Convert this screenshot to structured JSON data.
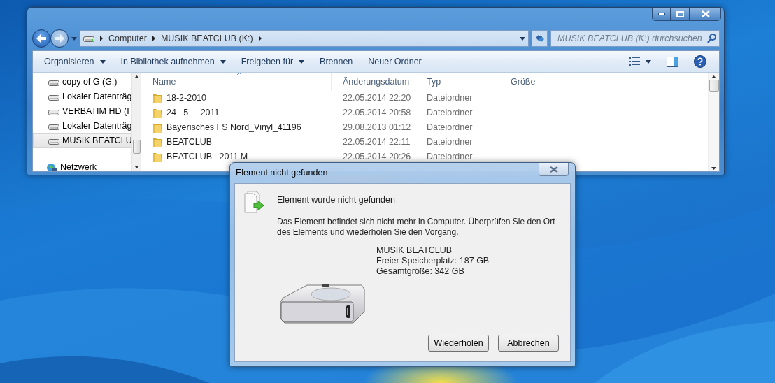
{
  "explorer": {
    "address": {
      "crumbs": [
        "Computer",
        "MUSIK BEATCLUB (K:)"
      ]
    },
    "search": {
      "placeholder": "MUSIK BEATCLUB (K:) durchsuchen"
    },
    "toolbar": [
      {
        "label": "Organisieren",
        "dropdown": true
      },
      {
        "label": "In Bibliothek aufnehmen",
        "dropdown": true
      },
      {
        "label": "Freigeben für",
        "dropdown": true
      },
      {
        "label": "Brennen",
        "dropdown": false
      },
      {
        "label": "Neuer Ordner",
        "dropdown": false
      }
    ],
    "nav": [
      {
        "label": "copy of G (G:)",
        "kind": "drive",
        "selected": false
      },
      {
        "label": "Lokaler Datenträg",
        "kind": "drive",
        "selected": false
      },
      {
        "label": "VERBATIM HD (I",
        "kind": "drive",
        "selected": false
      },
      {
        "label": "Lokaler Datenträg",
        "kind": "drive",
        "selected": false
      },
      {
        "label": "MUSIK BEATCLU",
        "kind": "drive",
        "selected": true
      },
      {
        "label": "Netzwerk",
        "kind": "network",
        "selected": false
      }
    ],
    "columns": [
      {
        "label": "Name",
        "sorted": true
      },
      {
        "label": "Änderungsdatum",
        "sorted": false
      },
      {
        "label": "Typ",
        "sorted": false
      },
      {
        "label": "Größe",
        "sorted": false
      }
    ],
    "rows": [
      {
        "name": "18-2-2010",
        "date": "22.05.2014 22:20",
        "type": "Dateiordner"
      },
      {
        "name": "24   5     2011",
        "date": "22.05.2014 20:58",
        "type": "Dateiordner"
      },
      {
        "name": "Bayerisches FS Nord_Vinyl_41196",
        "date": "29.08.2013 01:12",
        "type": "Dateiordner"
      },
      {
        "name": "BEATCLUB",
        "date": "22.05.2014 22:11",
        "type": "Dateiordner"
      },
      {
        "name": "BEATCLUB   2011 M",
        "date": "22.05.2014 20:26",
        "type": "Dateiordner"
      }
    ]
  },
  "dialog": {
    "title": "Element nicht gefunden",
    "heading": "Element wurde nicht gefunden",
    "message": "Das Element befindet sich nicht mehr in Computer. Überprüfen Sie den Ort des Elements und wiederholen Sie den Vorgang.",
    "drive": {
      "name": "MUSIK BEATCLUB",
      "free": "Freier Speicherplatz: 187 GB",
      "total": "Gesamtgröße: 342 GB"
    },
    "buttons": [
      "Wiederholen",
      "Abbrechen"
    ]
  }
}
